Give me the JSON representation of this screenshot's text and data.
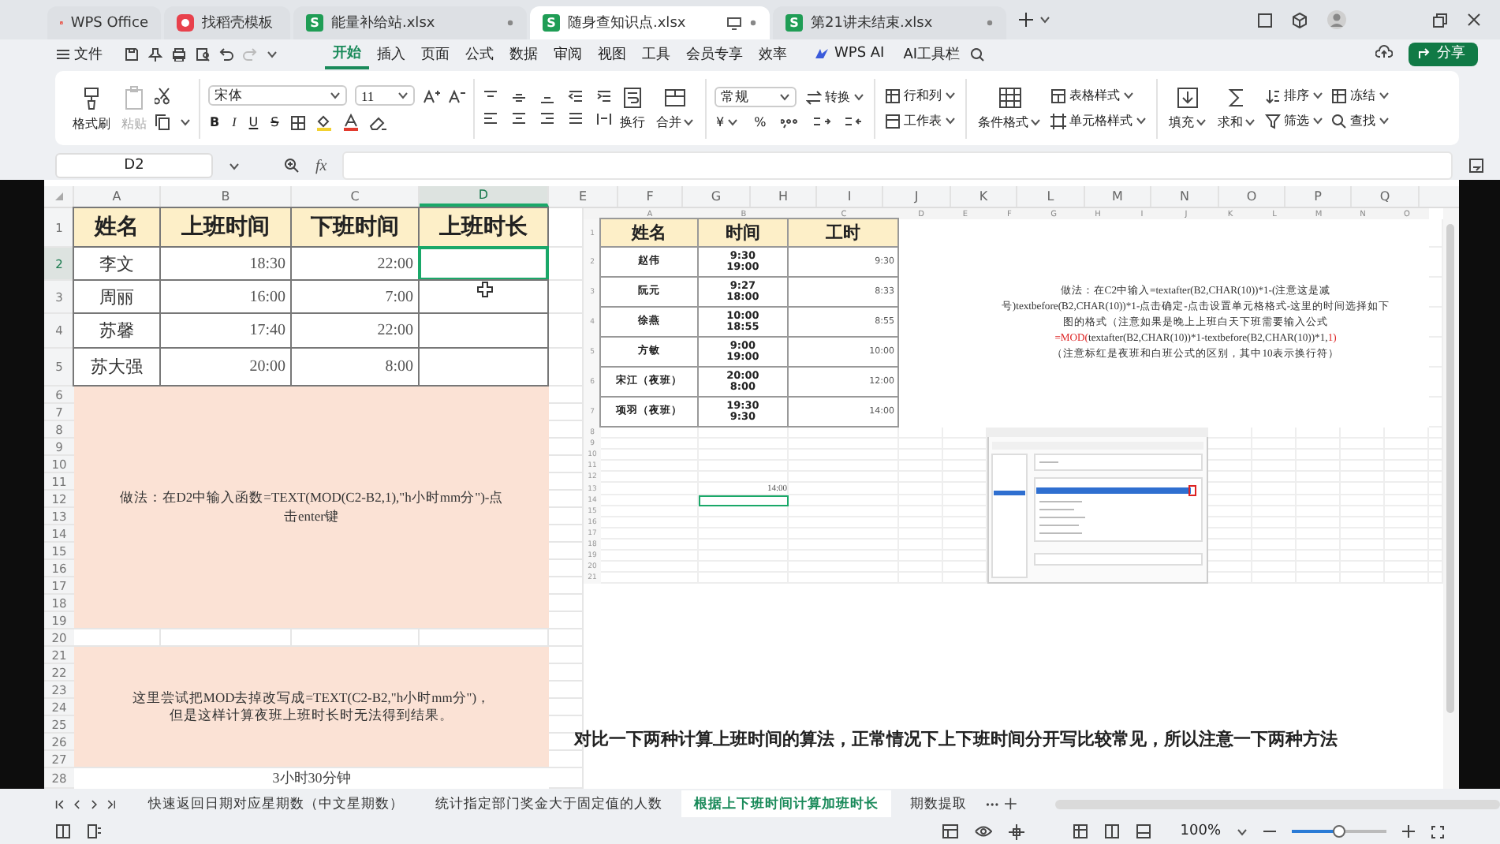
{
  "window_tabs": [
    {
      "label": "WPS Office",
      "kind": "home",
      "selected": false
    },
    {
      "label": "找稻壳模板",
      "kind": "template",
      "selected": false
    },
    {
      "label": "能量补给站.xlsx",
      "kind": "workbook",
      "badge": "S",
      "selected": false
    },
    {
      "label": "随身查知识点.xlsx",
      "kind": "workbook",
      "badge": "S",
      "selected": true
    },
    {
      "label": "第21讲未结束.xlsx",
      "kind": "workbook",
      "badge": "S",
      "selected": false
    }
  ],
  "menu": {
    "file": "文件",
    "tabs": [
      {
        "label": "开始",
        "selected": true
      },
      {
        "label": "插入",
        "selected": false
      },
      {
        "label": "页面",
        "selected": false
      },
      {
        "label": "公式",
        "selected": false
      },
      {
        "label": "数据",
        "selected": false
      },
      {
        "label": "审阅",
        "selected": false
      },
      {
        "label": "视图",
        "selected": false
      },
      {
        "label": "工具",
        "selected": false
      },
      {
        "label": "会员专享",
        "selected": false
      },
      {
        "label": "效率",
        "selected": false
      }
    ],
    "wps_ai": "WPS AI",
    "ai_toolbar": "AI工具栏",
    "share": "分享"
  },
  "ribbon": {
    "format_painter": "格式刷",
    "paste": {
      "label": "粘贴",
      "disabled": true
    },
    "font_name": "宋体",
    "font_size": "11",
    "style_buttons": [
      "B",
      "I",
      "U",
      "S"
    ],
    "wrap": "换行",
    "merge": "合并",
    "number_format": "常规",
    "convert": "转换",
    "currency": "¥",
    "percent": "%",
    "rows_cols": "行和列",
    "worksheet": "工作表",
    "conditional_format": "条件格式",
    "table_style": "表格样式",
    "cell_style": "单元格样式",
    "fill": "填充",
    "sum": "求和",
    "sort": "排序",
    "filter": "筛选",
    "freeze": "冻结",
    "find": "查找"
  },
  "formula_bar": {
    "cell_ref": "D2",
    "fx": "fx"
  },
  "sheet": {
    "columns": [
      {
        "label": "A",
        "selected": false
      },
      {
        "label": "B",
        "selected": false
      },
      {
        "label": "C",
        "selected": false
      },
      {
        "label": "D",
        "selected": true
      },
      {
        "label": "E",
        "selected": false
      },
      {
        "label": "F",
        "selected": false
      },
      {
        "label": "G",
        "selected": false
      },
      {
        "label": "H",
        "selected": false
      },
      {
        "label": "I",
        "selected": false
      },
      {
        "label": "J",
        "selected": false
      },
      {
        "label": "K",
        "selected": false
      },
      {
        "label": "L",
        "selected": false
      },
      {
        "label": "M",
        "selected": false
      },
      {
        "label": "N",
        "selected": false
      },
      {
        "label": "O",
        "selected": false
      },
      {
        "label": "P",
        "selected": false
      },
      {
        "label": "Q",
        "selected": false
      }
    ],
    "row_numbers": [
      {
        "label": "1",
        "selected": false
      },
      {
        "label": "2",
        "selected": true
      },
      {
        "label": "3",
        "selected": false
      },
      {
        "label": "4",
        "selected": false
      },
      {
        "label": "5",
        "selected": false
      },
      {
        "label": "6",
        "selected": false
      },
      {
        "label": "7",
        "selected": false
      },
      {
        "label": "8",
        "selected": false
      },
      {
        "label": "9",
        "selected": false
      },
      {
        "label": "10",
        "selected": false
      },
      {
        "label": "11",
        "selected": false
      },
      {
        "label": "12",
        "selected": false
      },
      {
        "label": "13",
        "selected": false
      },
      {
        "label": "14",
        "selected": false
      },
      {
        "label": "15",
        "selected": false
      },
      {
        "label": "16",
        "selected": false
      },
      {
        "label": "17",
        "selected": false
      },
      {
        "label": "18",
        "selected": false
      },
      {
        "label": "19",
        "selected": false
      },
      {
        "label": "20",
        "selected": false
      },
      {
        "label": "21",
        "selected": false
      },
      {
        "label": "22",
        "selected": false
      },
      {
        "label": "23",
        "selected": false
      },
      {
        "label": "24",
        "selected": false
      },
      {
        "label": "25",
        "selected": false
      },
      {
        "label": "26",
        "selected": false
      },
      {
        "label": "27",
        "selected": false
      },
      {
        "label": "28",
        "selected": false
      }
    ],
    "table": {
      "headers": [
        "姓名",
        "上班时间",
        "下班时间",
        "上班时长"
      ],
      "rows": [
        {
          "name": "李文",
          "start": "18:30",
          "end": "22:00",
          "selected": true
        },
        {
          "name": "周丽",
          "start": "16:00",
          "end": "7:00",
          "selected": false
        },
        {
          "name": "苏馨",
          "start": "17:40",
          "end": "22:00",
          "selected": false
        },
        {
          "name": "苏大强",
          "start": "20:00",
          "end": "8:00",
          "selected": false
        }
      ]
    },
    "note_1": "做法：在D2中输入函数=TEXT(MOD(C2-B2,1),\"h小时mm分\")-点击enter键",
    "note_2_lines": [
      "这里尝试把MOD去掉改写成=TEXT(C2-B2,\"h小时mm分\")，",
      "但是这样计算夜班上班时长时无法得到结果。"
    ],
    "row_28_text": "3小时30分钟"
  },
  "picture": {
    "columns": [
      "A",
      "B",
      "C",
      "D",
      "E",
      "F",
      "G",
      "H",
      "I",
      "J",
      "K",
      "L",
      "M",
      "N",
      "O"
    ],
    "row_numbers": [
      "1",
      "2",
      "3",
      "4",
      "5",
      "6",
      "7",
      "8",
      "9",
      "10",
      "11",
      "12",
      "13",
      "14",
      "15",
      "16",
      "17",
      "18",
      "19",
      "20",
      "21"
    ],
    "headers": [
      "姓名",
      "时间",
      "工时"
    ],
    "rows": [
      {
        "name": "赵伟",
        "times": [
          "9:30",
          "19:00"
        ],
        "hours": "9:30"
      },
      {
        "name": "阮元",
        "times": [
          "9:27",
          "18:00"
        ],
        "hours": "8:33"
      },
      {
        "name": "徐燕",
        "times": [
          "10:00",
          "18:55"
        ],
        "hours": "8:55"
      },
      {
        "name": "方敏",
        "times": [
          "9:00",
          "19:00"
        ],
        "hours": "10:00"
      },
      {
        "name": "宋江（夜班）",
        "times": [
          "20:00",
          "8:00"
        ],
        "hours": "12:00"
      },
      {
        "name": "项羽（夜班）",
        "times": [
          "19:30",
          "9:30"
        ],
        "hours": "14:00"
      }
    ],
    "b13_value": "14:00",
    "b14": {
      "selected": true
    },
    "note_segments": [
      {
        "kind": "plain",
        "text": "做法：在C2中输入=textafter(B2,CHAR(10))*1-(注意这是减号)textbefore(B2,CHAR(10))*1-点击确定-点击设置单元格格式-这里的时间选择如下图的格式（注意如果是晚上上班白天下班需要输入公式"
      },
      {
        "kind": "highlight",
        "text": "=MOD("
      },
      {
        "kind": "plain",
        "text": "textafter(B2,CHAR(10))*1-textbefore(B2,CHAR(10))*1,"
      },
      {
        "kind": "highlight",
        "text": "1)"
      },
      {
        "kind": "line",
        "text": "（注意标红是夜班和白班公式的区别，其中10表示换行符）"
      }
    ]
  },
  "comparison_note": "对比一下两种计算上班时间的算法，正常情况下上下班时间分开写比较常见，所以注意一下两种方法",
  "sheet_tabs": [
    {
      "label": "快速返回日期对应星期数（中文星期数）",
      "selected": false
    },
    {
      "label": "统计指定部门奖金大于固定值的人数",
      "selected": false
    },
    {
      "label": "根据上下班时间计算加班时长",
      "selected": true
    },
    {
      "label": "期数提取",
      "selected": false
    }
  ],
  "status_bar": {
    "zoom": "100%",
    "level": 0.5
  }
}
